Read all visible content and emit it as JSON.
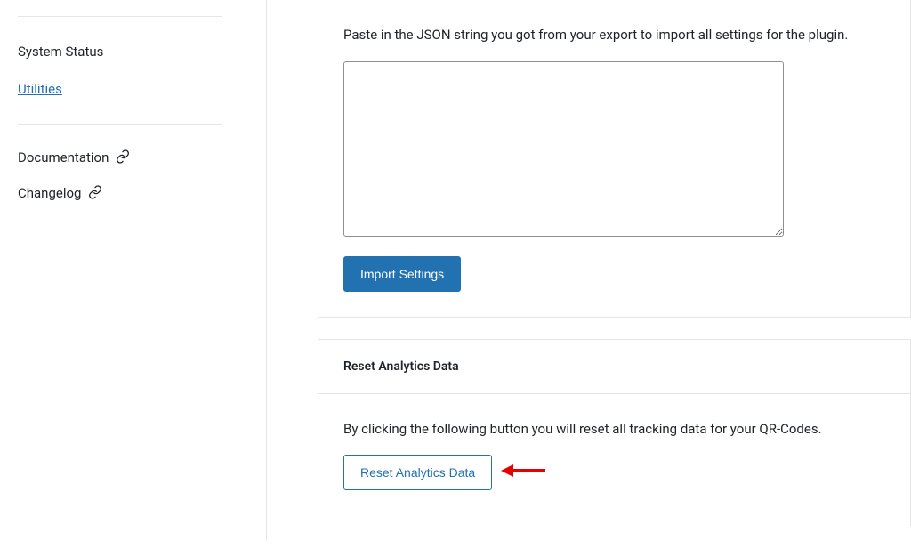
{
  "sidebar": {
    "items": [
      {
        "label": "System Status"
      },
      {
        "label": "Utilities"
      }
    ],
    "links": [
      {
        "label": "Documentation"
      },
      {
        "label": "Changelog"
      }
    ]
  },
  "import": {
    "description": "Paste in the JSON string you got from your export to import all settings for the plugin.",
    "textarea_value": "",
    "button_label": "Import Settings"
  },
  "reset": {
    "title": "Reset Analytics Data",
    "description": "By clicking the following button you will reset all tracking data for your QR-Codes.",
    "button_label": "Reset Analytics Data"
  }
}
